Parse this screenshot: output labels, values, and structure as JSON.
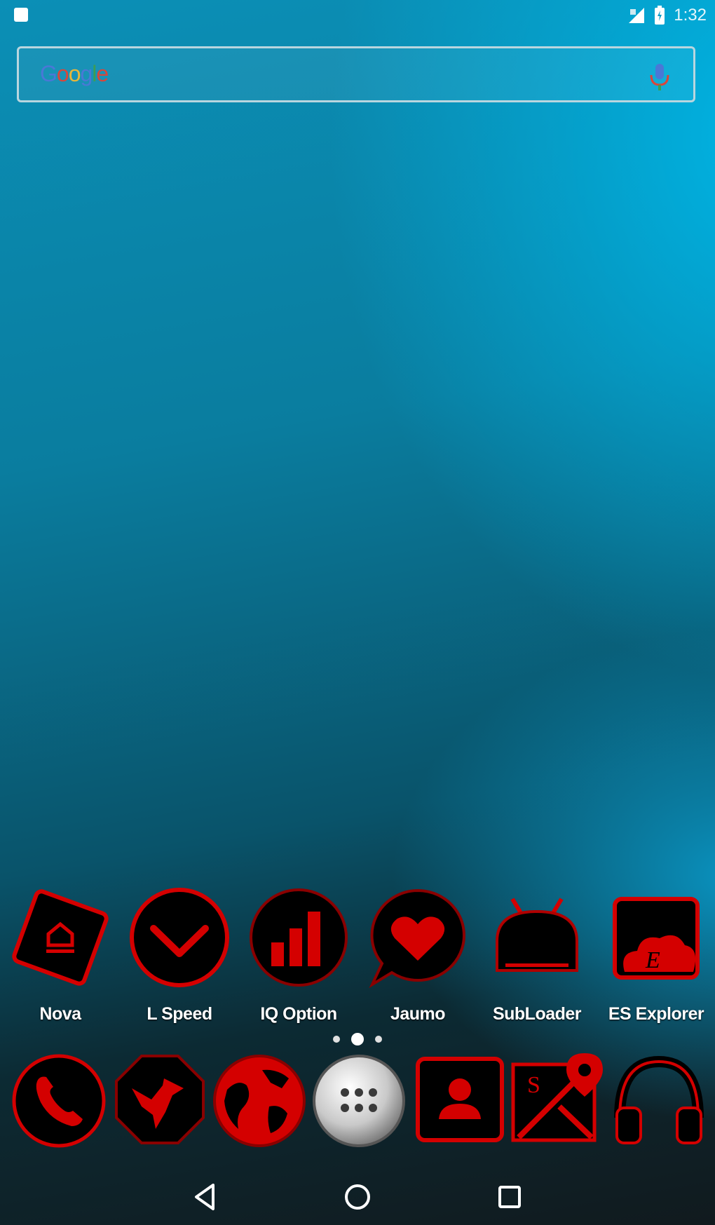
{
  "status_bar": {
    "time": "1:32",
    "icons": [
      "notification-icon",
      "signal-icon",
      "battery-icon"
    ]
  },
  "search": {
    "logo_letters": [
      "G",
      "o",
      "o",
      "g",
      "l",
      "e"
    ],
    "icon": "mic-icon"
  },
  "colors": {
    "accent_red": "#d40000",
    "icon_black": "#000000"
  },
  "apps": [
    {
      "label": "Nova",
      "icon": "nova-launcher-icon"
    },
    {
      "label": "L Speed",
      "icon": "chevron-down-icon"
    },
    {
      "label": "IQ Option",
      "icon": "bar-chart-icon"
    },
    {
      "label": "Jaumo",
      "icon": "heart-chat-icon"
    },
    {
      "label": "SubLoader",
      "icon": "android-robot-icon"
    },
    {
      "label": "ES Explorer",
      "icon": "cloud-folder-icon"
    }
  ],
  "page_indicator": {
    "count": 3,
    "active": 1
  },
  "dock": [
    {
      "icon": "phone-icon"
    },
    {
      "icon": "bird-icon"
    },
    {
      "icon": "globe-icon"
    },
    {
      "icon": "app-drawer-icon"
    },
    {
      "icon": "contacts-icon"
    },
    {
      "icon": "maps-icon"
    },
    {
      "icon": "headphones-icon"
    }
  ],
  "nav": [
    "back-icon",
    "home-icon",
    "recents-icon"
  ]
}
